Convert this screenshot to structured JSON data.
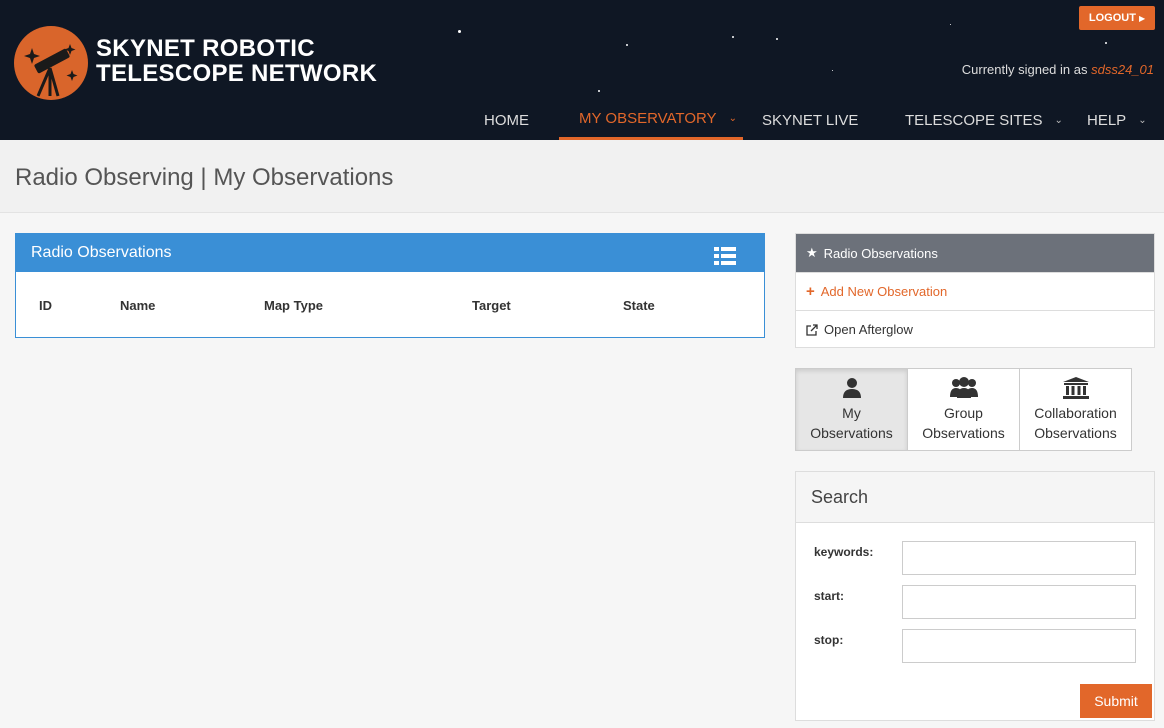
{
  "header": {
    "logo_line1": "SKYNET ROBOTIC",
    "logo_line2": "TELESCOPE NETWORK",
    "logout_label": "LOGOUT",
    "signed_in_prefix": "Currently signed in as",
    "username": "sdss24_01",
    "brand_color": "#e2672a"
  },
  "nav": {
    "items": [
      {
        "label": "HOME"
      },
      {
        "label": "MY OBSERVATORY"
      },
      {
        "label": "SKYNET LIVE"
      },
      {
        "label": "TELESCOPE SITES"
      },
      {
        "label": "HELP"
      }
    ]
  },
  "page": {
    "title": "Radio Observing | My Observations"
  },
  "observations": {
    "title": "Radio Observations",
    "columns": [
      "ID",
      "Name",
      "Map Type",
      "Target",
      "State"
    ]
  },
  "side_menu": {
    "title": "Radio Observations",
    "add_label": "Add New Observation",
    "afterglow_label": "Open Afterglow"
  },
  "tabs": [
    {
      "line1": "My",
      "line2": "Observations"
    },
    {
      "line1": "Group",
      "line2": "Observations"
    },
    {
      "line1": "Collaboration",
      "line2": "Observations"
    }
  ],
  "search": {
    "title": "Search",
    "keywords_label": "keywords:",
    "start_label": "start:",
    "stop_label": "stop:",
    "keywords_value": "",
    "start_value": "",
    "stop_value": "",
    "submit_label": "Submit"
  }
}
